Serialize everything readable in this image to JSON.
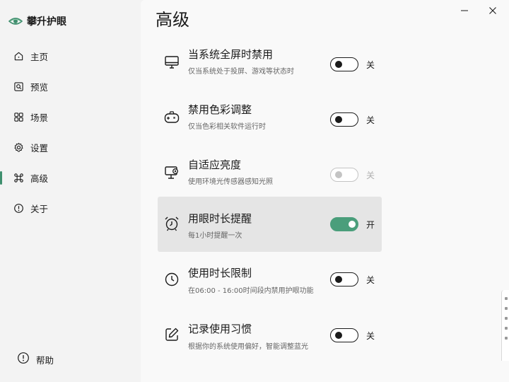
{
  "app": {
    "name": "攀升护眼"
  },
  "sidebar": {
    "items": [
      {
        "label": "主页",
        "icon": "home-icon"
      },
      {
        "label": "预览",
        "icon": "preview-icon"
      },
      {
        "label": "场景",
        "icon": "grid-icon"
      },
      {
        "label": "设置",
        "icon": "gear-icon"
      },
      {
        "label": "高级",
        "icon": "command-icon",
        "active": true
      },
      {
        "label": "关于",
        "icon": "info-icon"
      }
    ],
    "help": {
      "label": "帮助",
      "icon": "help-icon"
    }
  },
  "main": {
    "title": "高级",
    "settings": [
      {
        "title": "当系统全屏时禁用",
        "desc": "仅当系统处于投屏、游戏等状态时",
        "state": "off",
        "state_label": "关",
        "icon": "monitor-icon"
      },
      {
        "title": "禁用色彩调整",
        "desc": "仅当色彩相关软件运行时",
        "state": "off",
        "state_label": "关",
        "icon": "gamepad-icon"
      },
      {
        "title": "自适应亮度",
        "desc": "使用环境光传感器感知光照",
        "state": "off",
        "state_label": "关",
        "disabled": true,
        "icon": "brightness-monitor-icon"
      },
      {
        "title": "用眼时长提醒",
        "desc": "每1小时提醒一次",
        "state": "on",
        "state_label": "开",
        "highlighted": true,
        "icon": "alarm-clock-icon"
      },
      {
        "title": "使用时长限制",
        "desc": "在06:00 - 16:00时间段内禁用护眼功能",
        "state": "off",
        "state_label": "关",
        "icon": "clock-icon"
      },
      {
        "title": "记录使用习惯",
        "desc": "根据你的系统使用偏好，智能调整蓝光",
        "state": "off",
        "state_label": "关",
        "icon": "edit-icon"
      }
    ]
  },
  "colors": {
    "accent": "#4a9e7b",
    "highlight": "#e5e5e5",
    "sidebar_bg": "#f3f3f3"
  }
}
